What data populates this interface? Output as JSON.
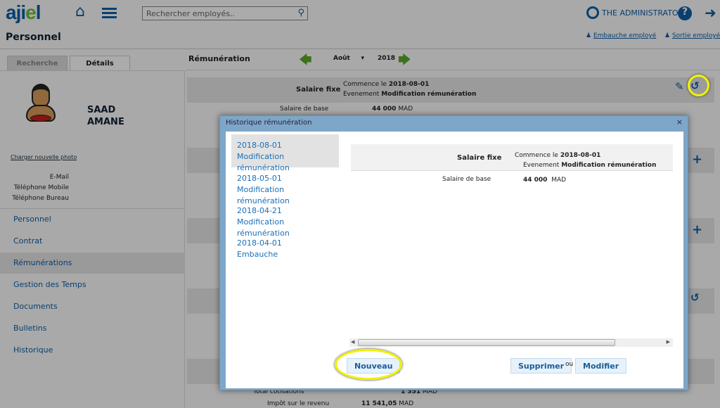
{
  "header": {
    "logo_main": "aji",
    "logo_dot": "e",
    "logo_end": "l",
    "search_placeholder": "Rechercher employés..",
    "user": "THE ADMINISTRATOR",
    "embauche": "Embauche employé",
    "sortie": "Sortie employé"
  },
  "page_title": "Personnel",
  "tabs": [
    {
      "label": "Recherche"
    },
    {
      "label": "Détails"
    }
  ],
  "employee": {
    "first": "SAAD",
    "last": "AMANE",
    "upload_photo": "Charger nouvelle photo",
    "fields": [
      "E-Mail",
      "Téléphone Mobile",
      "Téléphone Bureau"
    ]
  },
  "sidebar": {
    "items": [
      {
        "label": "Personnel"
      },
      {
        "label": "Contrat"
      },
      {
        "label": "Rémunérations"
      },
      {
        "label": "Gestion des Temps"
      },
      {
        "label": "Documents"
      },
      {
        "label": "Bulletins"
      },
      {
        "label": "Historique"
      }
    ],
    "selected": "Rémunérations"
  },
  "main": {
    "title": "Rémunération",
    "month": "Août",
    "year": "2018",
    "salaire_fixe": {
      "label": "Salaire fixe",
      "commence_label": "Commence le",
      "commence": "2018-08-01",
      "evenement_label": "Evenement",
      "evenement": "Modification rémunération",
      "base_label": "Salaire de base",
      "base_value": "44 000",
      "currency": "MAD"
    },
    "total_cot_label": "Total cotisations",
    "total_cot_value": "1 351",
    "impot_label": "Impôt sur le revenu",
    "impot_value": "11 541,05"
  },
  "modal": {
    "title": "Historique rémunération",
    "close": "×",
    "history": [
      {
        "date": "2018-08-01",
        "event": "Modification rémunération"
      },
      {
        "date": "2018-05-01",
        "event": "Modification rémunération"
      },
      {
        "date": "2018-04-21",
        "event": "Modification rémunération"
      },
      {
        "date": "2018-04-01",
        "event": "Embauche"
      }
    ],
    "detail": {
      "label": "Salaire fixe",
      "commence_label": "Commence le",
      "commence": "2018-08-01",
      "evenement_label": "Evenement",
      "evenement": "Modification rémunération",
      "base_label": "Salaire de base",
      "base_value": "44 000",
      "currency": "MAD"
    },
    "nouveau": "Nouveau",
    "supprimer": "Supprimer",
    "ou": "ou",
    "modifier": "Modifier"
  },
  "colors": {
    "brand": "#0d5ea8",
    "accent_green": "#6abf3a",
    "modal_header": "#7ea6c8",
    "highlight": "#f2f200"
  }
}
